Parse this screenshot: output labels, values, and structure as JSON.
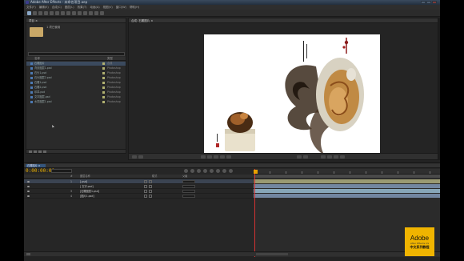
{
  "window": {
    "title": "Adobe After Effects - 未命名项目.aep"
  },
  "menu": [
    "文件(F)",
    "编辑(E)",
    "合成(C)",
    "图层(L)",
    "效果(T)",
    "动画(A)",
    "视图(V)",
    "窗口(W)",
    "帮助(H)"
  ],
  "project": {
    "tab_label": "项目 ×",
    "thumb_info": "1 项已使用",
    "columns": {
      "name": "名称",
      "label": "",
      "type": "类型"
    },
    "items": [
      {
        "name": "石雕图片",
        "type": "合成",
        "selected": true
      },
      {
        "name": "背景图层1.psd",
        "type": "Photoshop"
      },
      {
        "name": "石头1.psd",
        "type": "Photoshop"
      },
      {
        "name": "石头图层2.psd",
        "type": "Photoshop"
      },
      {
        "name": "石雕1.psd",
        "type": "Photoshop"
      },
      {
        "name": "石雕2.psd",
        "type": "Photoshop"
      },
      {
        "name": "印章.psd",
        "type": "Photoshop"
      },
      {
        "name": "文字图层.psd",
        "type": "Photoshop"
      },
      {
        "name": "水墨图层1.psd",
        "type": "Photoshop"
      }
    ]
  },
  "viewer": {
    "tab_label": "合成: 石雕图片 ×"
  },
  "timeline": {
    "tab_label": "石雕图片 ×",
    "timecode": "0:00:00:00",
    "layer_header": {
      "num": "#",
      "name": "图层名称",
      "mode": "模式",
      "parent": "父级"
    },
    "layers": [
      {
        "num": "1",
        "name": "[.psd]",
        "selected": true
      },
      {
        "name": "[ 文字.psd]"
      },
      {
        "num": "3",
        "name": "[石雕图层1.psd]"
      },
      {
        "num": "4",
        "name": "[图片1.psd]"
      }
    ]
  },
  "watermark": {
    "line1": "Adobe",
    "line2": "After Effects CS",
    "line3": "中文系列教程"
  },
  "colors": {
    "timecode": "#f0b400",
    "selection": "#3b4a5e",
    "cti": "#d03030"
  }
}
